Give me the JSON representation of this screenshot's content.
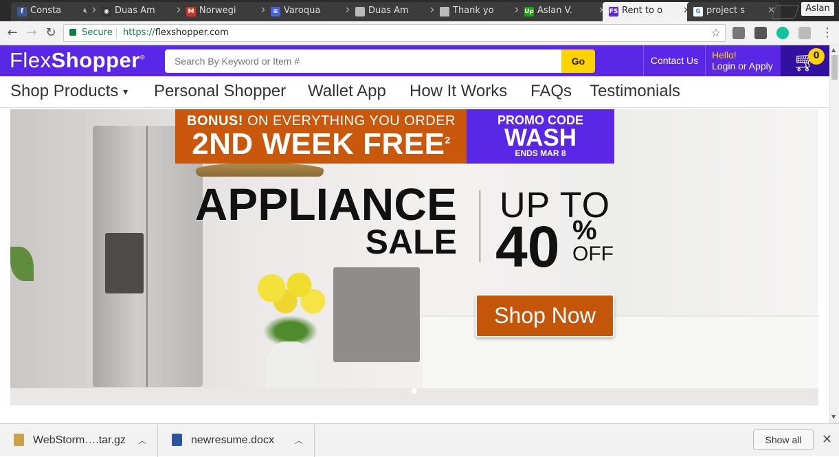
{
  "browser": {
    "tabs": [
      {
        "title": "Consta",
        "icon": "facebook-icon",
        "color": "#3b5998",
        "glyph": "f",
        "muted": true
      },
      {
        "title": "Duas Am",
        "icon": "github-icon",
        "color": "#333333",
        "glyph": "◉",
        "muted": false
      },
      {
        "title": "Norwegi",
        "icon": "gmail-icon",
        "color": "#d93025",
        "glyph": "M",
        "muted": false
      },
      {
        "title": "Varoqua",
        "icon": "docs-icon",
        "color": "#4a63d8",
        "glyph": "≡",
        "muted": false
      },
      {
        "title": "Duas Am",
        "icon": "document-icon",
        "color": "#bbbbbb",
        "glyph": "",
        "muted": false
      },
      {
        "title": "Thank yo",
        "icon": "document-icon",
        "color": "#bbbbbb",
        "glyph": "",
        "muted": false
      },
      {
        "title": "Aslan V.",
        "icon": "upwork-icon",
        "color": "#14a800",
        "glyph": "Up",
        "muted": false
      },
      {
        "title": "Rent to o",
        "icon": "flexshopper-icon",
        "color": "#5a27e6",
        "glyph": "FS",
        "muted": false,
        "active": true
      },
      {
        "title": "project s",
        "icon": "google-icon",
        "color": "#ffffff",
        "glyph": "G",
        "muted": false
      }
    ],
    "user": "Aslan",
    "secure_label": "Secure",
    "url_scheme": "https://",
    "url_host": "flexshopper.com"
  },
  "site": {
    "logo_light": "Flex",
    "logo_bold": "Shopper",
    "logo_mark": "®",
    "search_placeholder": "Search By Keyword or Item #",
    "go_label": "Go",
    "contact_label": "Contact Us",
    "hello": "Hello!",
    "login_label": "Login or Apply",
    "cart_count": "0",
    "nav": [
      {
        "label": "Shop Products",
        "dropdown": true
      },
      {
        "label": "Personal Shopper"
      },
      {
        "label": "Wallet App"
      },
      {
        "label": "How It Works"
      },
      {
        "label": "FAQs"
      },
      {
        "label": "Testimonials"
      }
    ],
    "colors": {
      "brand": "#5a27e6",
      "accent": "#ffd200",
      "promo_orange": "#c9580c"
    }
  },
  "hero": {
    "bonus_prefix": "BONUS!",
    "bonus_text": "ON EVERYTHING YOU ORDER",
    "free_text": "2ND WEEK FREE",
    "free_sup": "2",
    "promo_code_label": "PROMO CODE",
    "promo_code": "WASH",
    "promo_ends": "ENDS MAR 8",
    "title_line1": "APPLIANCE",
    "title_line2": "SALE",
    "up_to": "UP TO",
    "percent": "40",
    "percent_sign": "%",
    "off": "OFF",
    "cta": "Shop Now"
  },
  "downloads": {
    "items": [
      {
        "name": "WebStorm….tar.gz",
        "icon": "archive-icon",
        "color": "#c9a24a"
      },
      {
        "name": "newresume.docx",
        "icon": "word-doc-icon",
        "color": "#2b579a"
      }
    ],
    "show_all": "Show all"
  }
}
